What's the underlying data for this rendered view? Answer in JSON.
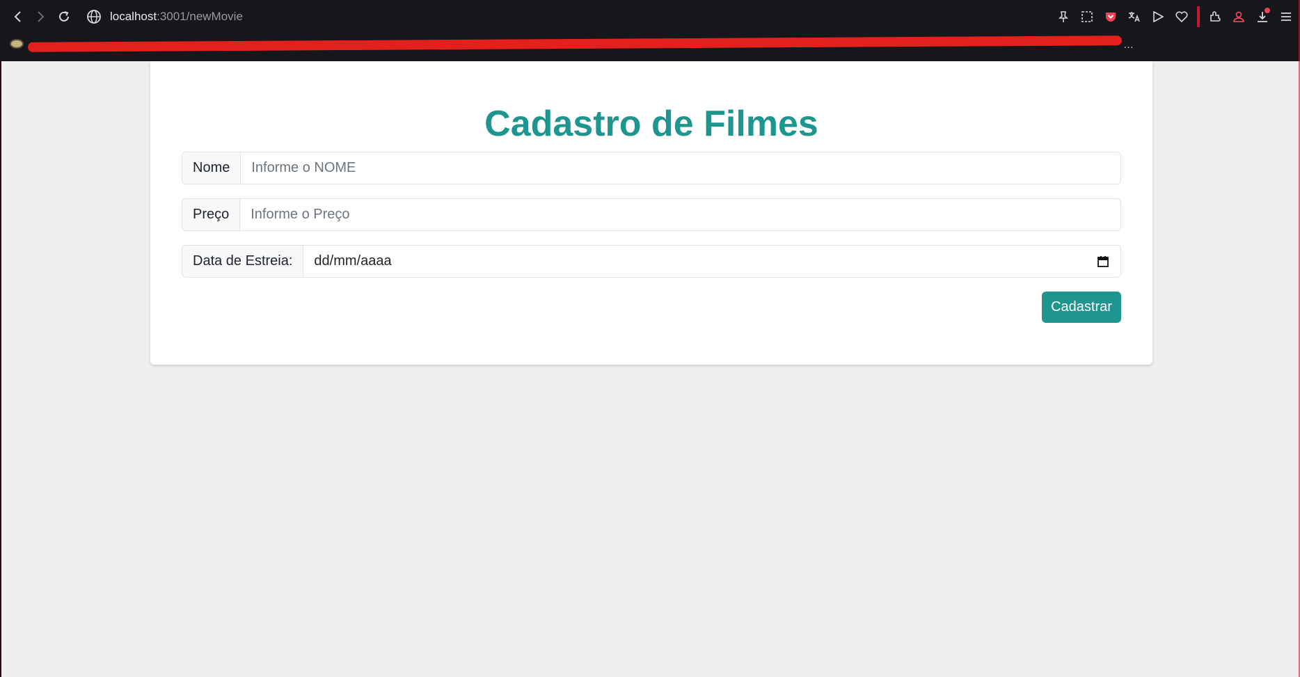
{
  "browser": {
    "url_host": "localhost",
    "url_path": ":3001/newMovie",
    "bookmarks_ellipsis": "…",
    "icons": [
      "back-icon",
      "forward-icon",
      "reload-icon",
      "globe-icon",
      "pin-icon",
      "screenshot-icon",
      "pocket-icon",
      "translate-icon",
      "send-icon",
      "heart-icon",
      "extensions-icon",
      "profile-icon",
      "download-icon",
      "menu-icon"
    ],
    "accent_color": "#c8153a"
  },
  "form": {
    "title": "Cadastro de Filmes",
    "nome_label": "Nome",
    "nome_placeholder": "Informe o NOME",
    "preco_label": "Preço",
    "preco_placeholder": "Informe o Preço",
    "data_label": "Data de Estreia:",
    "data_placeholder": "dd/mm/aaaa",
    "submit_label": "Cadastrar",
    "accent_color": "#1f9590"
  }
}
